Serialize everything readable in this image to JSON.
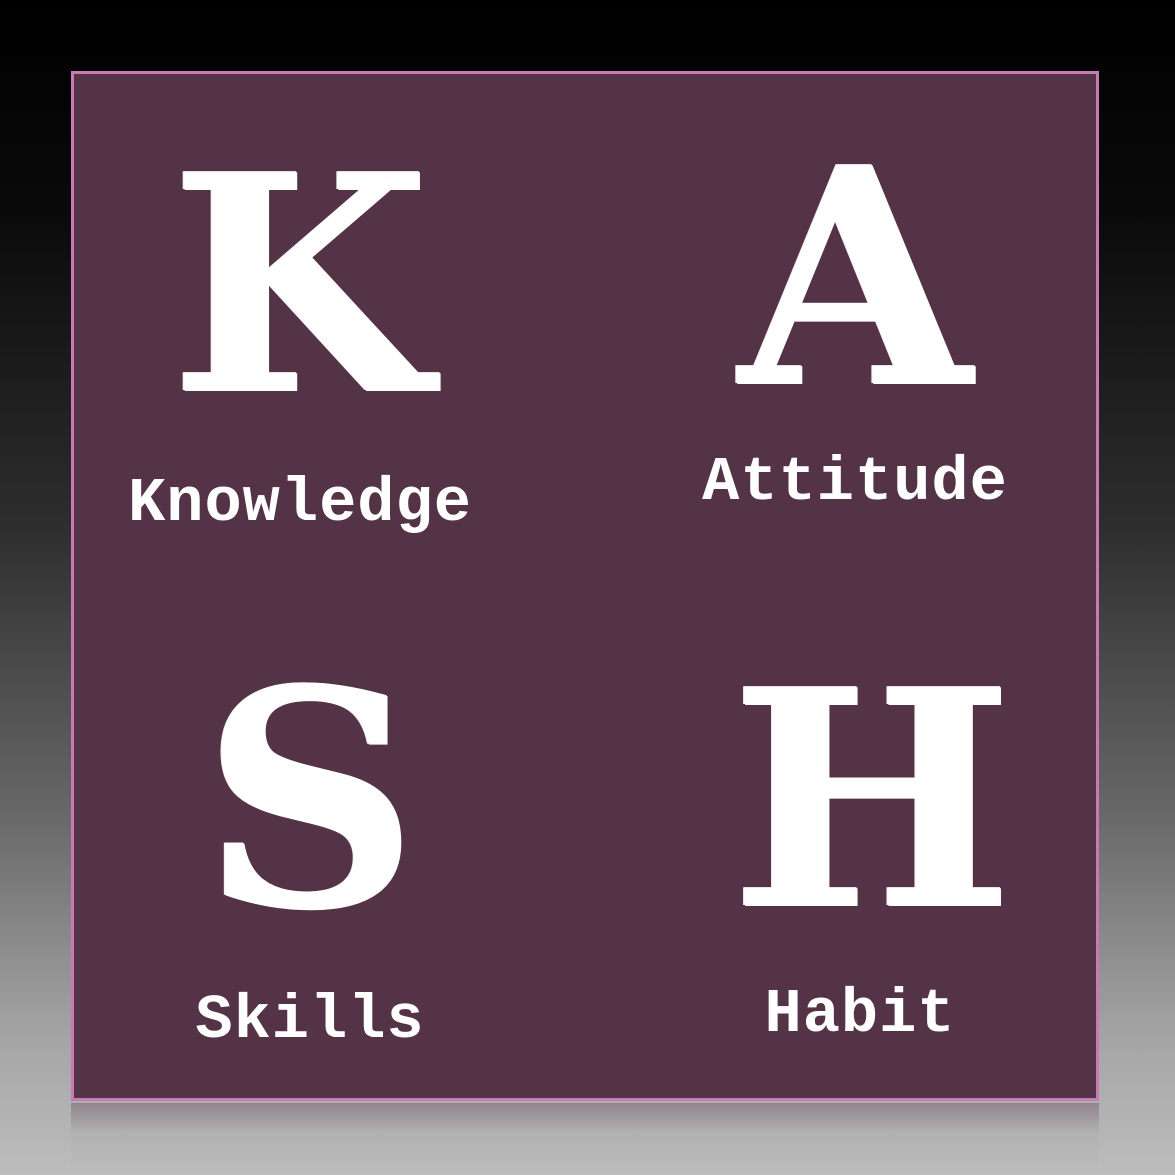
{
  "colors": {
    "card_background": "#543347",
    "card_border": "#c67bb3",
    "text": "#ffffff"
  },
  "quadrants": [
    {
      "letter": "K",
      "word": "Knowledge"
    },
    {
      "letter": "A",
      "word": "Attitude"
    },
    {
      "letter": "S",
      "word": "Skills"
    },
    {
      "letter": "H",
      "word": "Habit"
    }
  ]
}
